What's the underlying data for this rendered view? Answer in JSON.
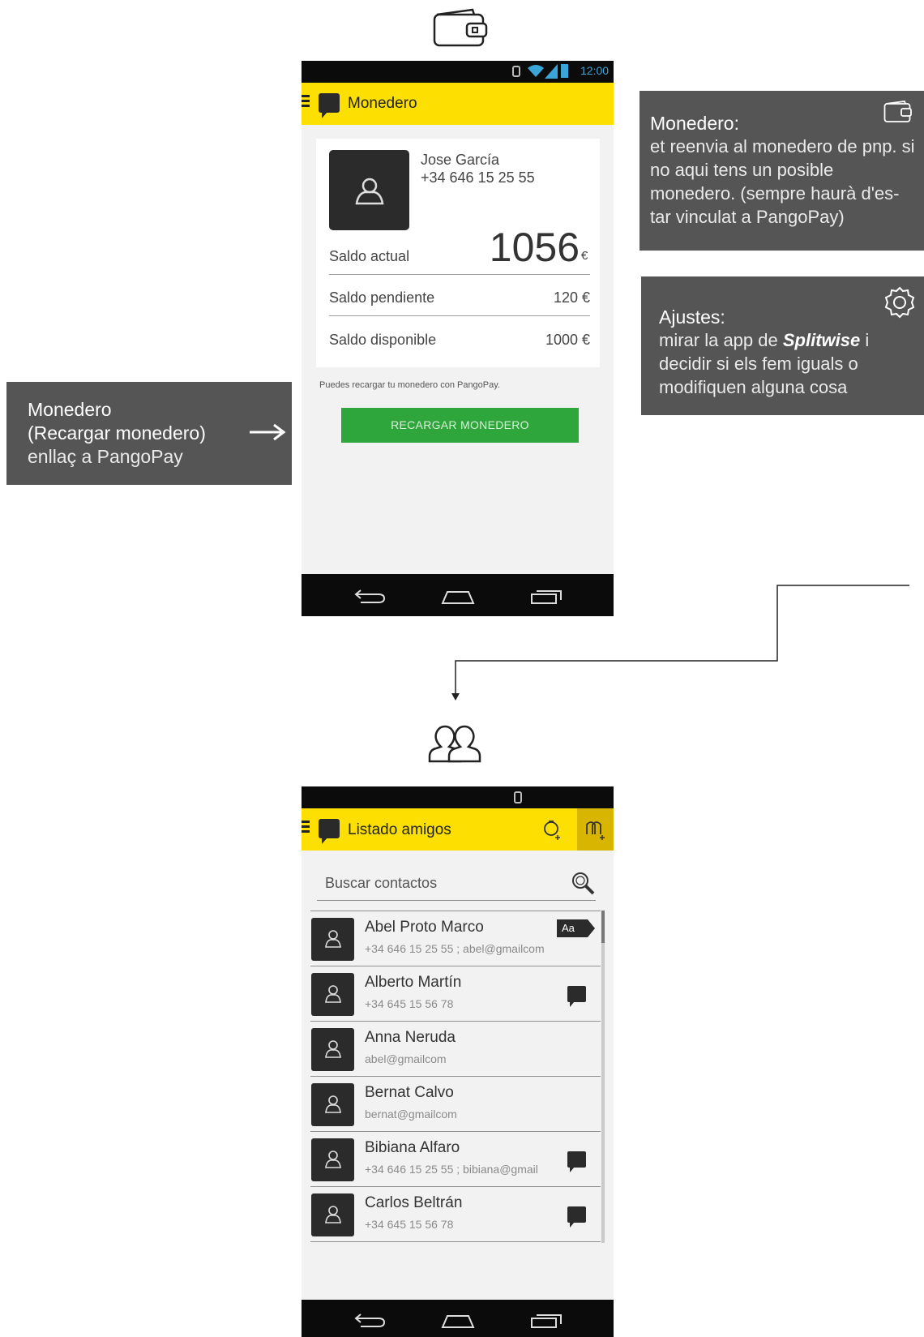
{
  "wallet_screen": {
    "status_time": "12:00",
    "title": "Monedero",
    "user_name": "Jose García",
    "user_phone": "+34 646 15 25 55",
    "balance_label": "Saldo actual",
    "balance_value": "1056",
    "currency": "€",
    "pending_label": "Saldo pendiente",
    "pending_value": "120 €",
    "available_label": "Saldo disponible",
    "available_value": "1000 €",
    "recharge_hint": "Puedes recargar tu monedero con PangoPay.",
    "recharge_button": "RECARGAR MONEDERO"
  },
  "notes": {
    "wallet_title": "Monedero:",
    "wallet_body": "et reenvia al monedero de pnp. si no aqui tens un posible monedero. (sempre haurà d'es-tar vinculat a PangoPay)",
    "settings_title": "Ajustes:",
    "settings_pre": "mirar la app de ",
    "settings_em": "Splitwise",
    "settings_post": " i decidir si els fem iguals o modifiquen alguna cosa",
    "recharge_line1": "Monedero",
    "recharge_line2": "(Recargar monedero)",
    "recharge_line3": "enllaç a PangoPay"
  },
  "friends_screen": {
    "title": "Listado amigos",
    "search_placeholder": "Buscar contactos",
    "aa_badge": "Aa",
    "contacts": [
      {
        "name": "Abel Proto Marco",
        "detail": "+34 646 15 25 55   ; abel@gmailcom"
      },
      {
        "name": "Alberto Martín",
        "detail": "+34 645 15 56 78"
      },
      {
        "name": "Anna Neruda",
        "detail": "abel@gmailcom"
      },
      {
        "name": "Bernat Calvo",
        "detail": "bernat@gmailcom"
      },
      {
        "name": "Bibiana Alfaro",
        "detail": "+34 646 15 25 55   ; bibiana@gmail"
      },
      {
        "name": "Carlos Beltrán",
        "detail": "+34 645 15 56 78"
      }
    ]
  },
  "icons": [
    "wallet-icon",
    "friends-icon",
    "gear-icon",
    "search-icon",
    "back-icon",
    "home-icon",
    "recents-icon",
    "bluetooth-icon",
    "wifi-icon",
    "signal-icon",
    "battery-icon",
    "avatar-icon",
    "chat-icon",
    "add-expense-icon",
    "add-friends-icon"
  ],
  "colors": {
    "appbar": "#fde001",
    "button": "#2ea63b",
    "annotation": "#555555",
    "statusbar": "#0b0b0b"
  }
}
